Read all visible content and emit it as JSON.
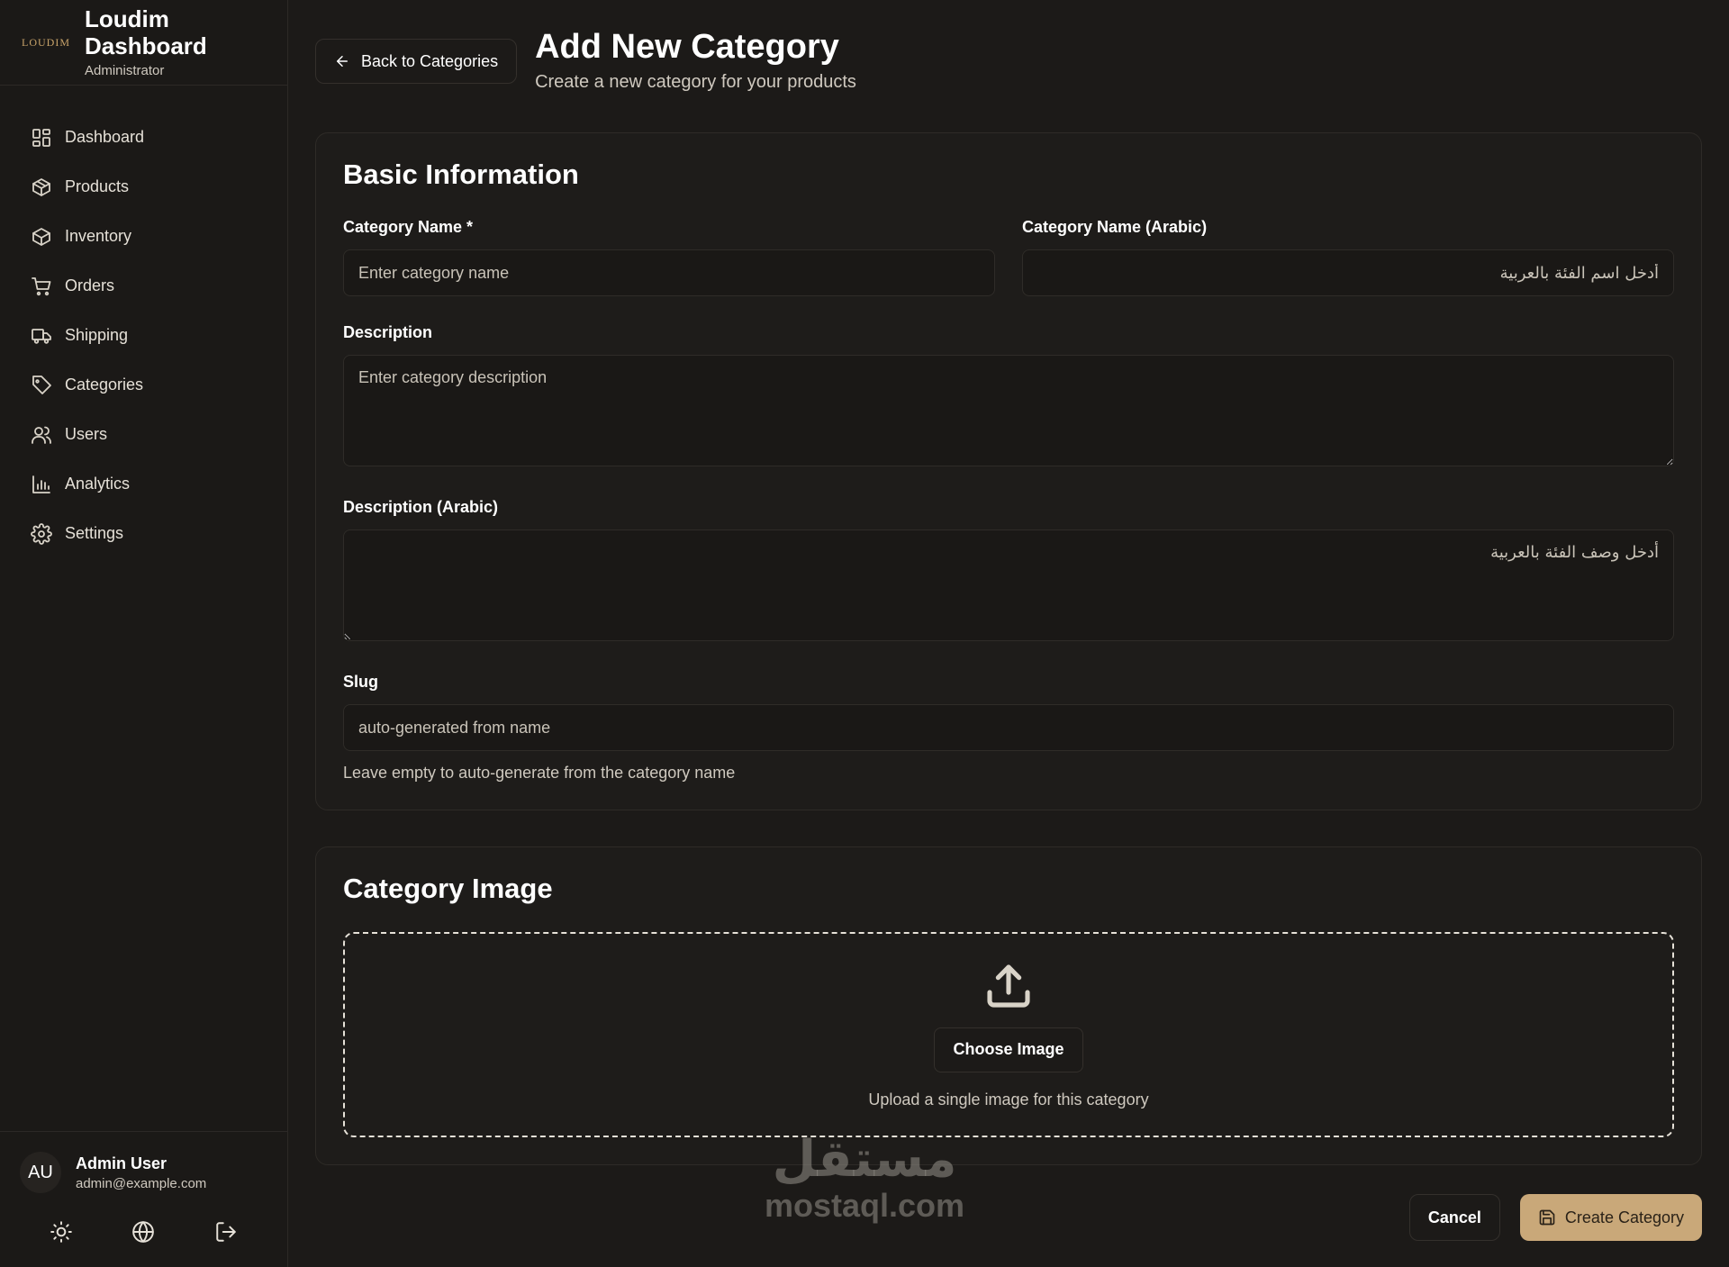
{
  "brand": {
    "logo_text": "LOUDIM",
    "title": "Loudim Dashboard",
    "role": "Administrator"
  },
  "nav": {
    "items": [
      {
        "label": "Dashboard",
        "icon": "dashboard-icon"
      },
      {
        "label": "Products",
        "icon": "package-icon"
      },
      {
        "label": "Inventory",
        "icon": "package-icon"
      },
      {
        "label": "Orders",
        "icon": "cart-icon"
      },
      {
        "label": "Shipping",
        "icon": "truck-icon"
      },
      {
        "label": "Categories",
        "icon": "tag-icon"
      },
      {
        "label": "Users",
        "icon": "users-icon"
      },
      {
        "label": "Analytics",
        "icon": "bar-chart-icon"
      },
      {
        "label": "Settings",
        "icon": "gear-icon"
      }
    ]
  },
  "user": {
    "initials": "AU",
    "name": "Admin User",
    "email": "admin@example.com"
  },
  "header": {
    "back_label": "Back to Categories",
    "title": "Add New Category",
    "subtitle": "Create a new category for your products"
  },
  "basic_info": {
    "title": "Basic Information",
    "name_label": "Category Name *",
    "name_placeholder": "Enter category name",
    "name_ar_label": "Category Name (Arabic)",
    "name_ar_placeholder": "أدخل اسم الفئة بالعربية",
    "desc_label": "Description",
    "desc_placeholder": "Enter category description",
    "desc_ar_label": "Description (Arabic)",
    "desc_ar_placeholder": "أدخل وصف الفئة بالعربية",
    "slug_label": "Slug",
    "slug_placeholder": "auto-generated from name",
    "slug_hint": "Leave empty to auto-generate from the category name"
  },
  "image": {
    "title": "Category Image",
    "choose_label": "Choose Image",
    "hint": "Upload a single image for this category"
  },
  "actions": {
    "cancel_label": "Cancel",
    "create_label": "Create Category"
  },
  "watermark": {
    "arabic": "مستقل",
    "latin": "mostaql.com"
  },
  "colors": {
    "accent": "#c9a879",
    "background": "#1c1a18"
  }
}
